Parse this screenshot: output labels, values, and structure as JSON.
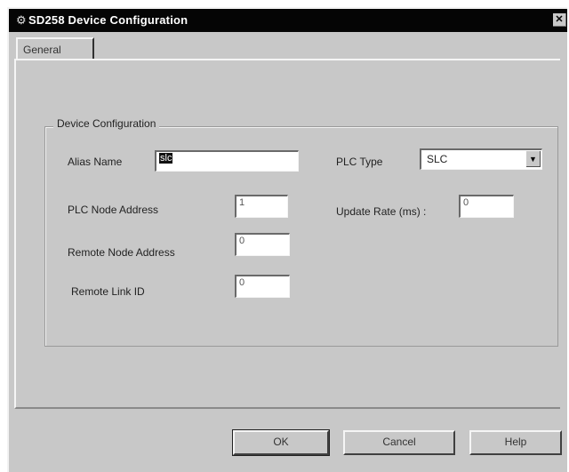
{
  "window": {
    "title": "SD258 Device Configuration",
    "title_icon": "device-icon",
    "close_glyph": "✕"
  },
  "tabs": [
    {
      "label": "General",
      "active": true
    }
  ],
  "group": {
    "legend": "Device Configuration"
  },
  "fields": {
    "alias_name": {
      "label": "Alias Name",
      "value": "slc"
    },
    "plc_type": {
      "label": "PLC Type",
      "value": "SLC"
    },
    "plc_node_address": {
      "label": "PLC Node Address",
      "value": "1"
    },
    "update_rate": {
      "label": "Update Rate (ms) :",
      "value": "0"
    },
    "remote_node_address": {
      "label": "Remote Node Address",
      "value": "0"
    },
    "remote_link_id": {
      "label": "Remote Link ID",
      "value": "0"
    }
  },
  "buttons": {
    "ok": "OK",
    "cancel": "Cancel",
    "help": "Help"
  },
  "colors": {
    "titlebar": "#050505",
    "dialog_face": "#c8c8c8",
    "field_bg": "#ffffff",
    "selection": "#111111"
  }
}
